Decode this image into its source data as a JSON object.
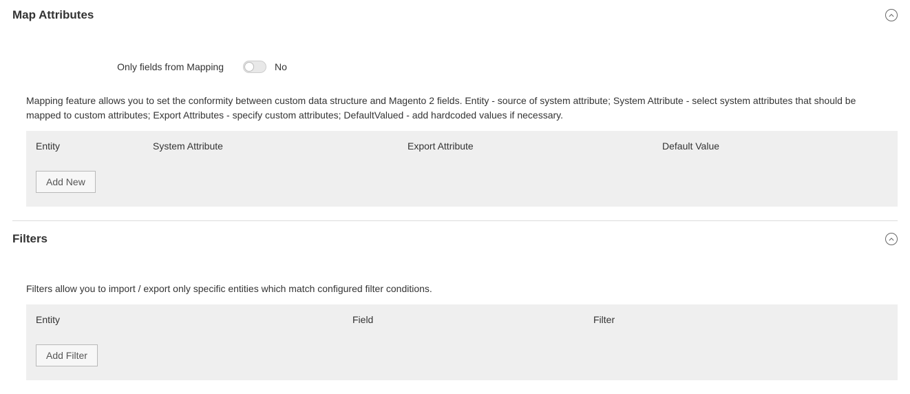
{
  "mapAttributes": {
    "title": "Map Attributes",
    "onlyFieldsLabel": "Only fields from Mapping",
    "onlyFieldsValue": "No",
    "description": "Mapping feature allows you to set the conformity between custom data structure and Magento 2 fields. Entity - source of system attribute; System Attribute - select system attributes that should be mapped to custom attributes; Export Attributes - specify custom attributes; DefaultValued - add hardcoded values if necessary.",
    "columns": {
      "entity": "Entity",
      "systemAttribute": "System Attribute",
      "exportAttribute": "Export Attribute",
      "defaultValue": "Default Value"
    },
    "addNewLabel": "Add New"
  },
  "filters": {
    "title": "Filters",
    "description": "Filters allow you to import / export only specific entities which match configured filter conditions.",
    "columns": {
      "entity": "Entity",
      "field": "Field",
      "filter": "Filter"
    },
    "addFilterLabel": "Add Filter"
  }
}
